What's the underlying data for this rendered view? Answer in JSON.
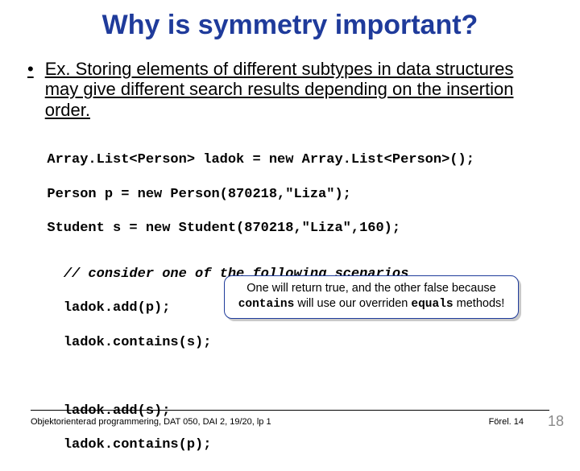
{
  "title": "Why is symmetry important?",
  "bullet": "Ex. Storing elements of different subtypes in data structures may give different search results depending on the insertion order.",
  "code1_line1": "Array.List<Person> ladok = new Array.List<Person>();",
  "code1_line2": "Person p = new Person(870218,\"Liza\");",
  "code1_line3": "Student s = new Student(870218,\"Liza\",160);",
  "comment": "// consider one of the following scenarios",
  "code2_line1": "ladok.add(p);",
  "code2_line2": "ladok.contains(s);",
  "code3_line1": "ladok.add(s);",
  "code3_line2": "ladok.contains(p);",
  "callout_part1": "One will return true, and the other false because ",
  "callout_kw1": "contains",
  "callout_part2": " will use our overriden ",
  "callout_kw2": "equals",
  "callout_part3": " methods!",
  "footer_left": "Objektorienterad programmering, DAT 050, DAI 2, 19/20, lp 1",
  "footer_right": "Förel. 14",
  "page_num": "18"
}
